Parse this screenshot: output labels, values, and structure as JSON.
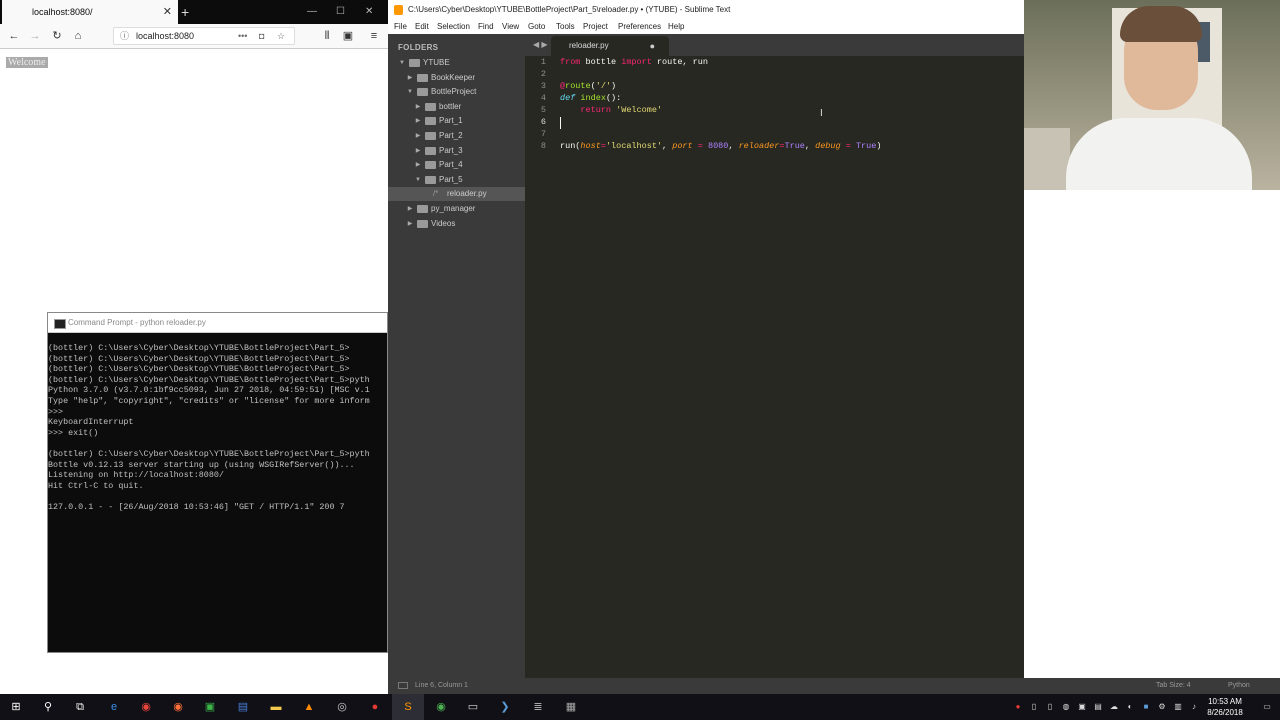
{
  "browser": {
    "tab_title": "localhost:8080/",
    "tab_close": "✕",
    "new_tab": "+",
    "url": "localhost:8080",
    "page_text": "Welcome",
    "window_controls": [
      "—",
      "☐",
      "✕"
    ]
  },
  "cmd": {
    "title": "Command Prompt - python  reloader.py",
    "lines": [
      "(bottler) C:\\Users\\Cyber\\Desktop\\YTUBE\\BottleProject\\Part_5>",
      "(bottler) C:\\Users\\Cyber\\Desktop\\YTUBE\\BottleProject\\Part_5>",
      "(bottler) C:\\Users\\Cyber\\Desktop\\YTUBE\\BottleProject\\Part_5>",
      "(bottler) C:\\Users\\Cyber\\Desktop\\YTUBE\\BottleProject\\Part_5>pyth",
      "Python 3.7.0 (v3.7.0:1bf9cc5093, Jun 27 2018, 04:59:51) [MSC v.1",
      "Type \"help\", \"copyright\", \"credits\" or \"license\" for more inform",
      ">>>",
      "KeyboardInterrupt",
      ">>> exit()",
      "",
      "(bottler) C:\\Users\\Cyber\\Desktop\\YTUBE\\BottleProject\\Part_5>pyth",
      "Bottle v0.12.13 server starting up (using WSGIRefServer())...",
      "Listening on http://localhost:8080/",
      "Hit Ctrl-C to quit.",
      "",
      "127.0.0.1 - - [26/Aug/2018 10:53:46] \"GET / HTTP/1.1\" 200 7"
    ]
  },
  "sublime": {
    "title": "C:\\Users\\Cyber\\Desktop\\YTUBE\\BottleProject\\Part_5\\reloader.py • (YTUBE) - Sublime Text",
    "menu": [
      "File",
      "Edit",
      "Selection",
      "Find",
      "View",
      "Goto",
      "Tools",
      "Project",
      "Preferences",
      "Help"
    ],
    "folders_header": "FOLDERS",
    "tree": [
      {
        "label": "YTUBE",
        "depth": 0,
        "open": true
      },
      {
        "label": "BookKeeper",
        "depth": 1,
        "open": false
      },
      {
        "label": "BottleProject",
        "depth": 1,
        "open": true
      },
      {
        "label": "bottler",
        "depth": 2,
        "open": false
      },
      {
        "label": "Part_1",
        "depth": 2,
        "open": false
      },
      {
        "label": "Part_2",
        "depth": 2,
        "open": false
      },
      {
        "label": "Part_3",
        "depth": 2,
        "open": false
      },
      {
        "label": "Part_4",
        "depth": 2,
        "open": false
      },
      {
        "label": "Part_5",
        "depth": 2,
        "open": true
      },
      {
        "label": "reloader.py",
        "depth": 3,
        "file": true
      },
      {
        "label": "py_manager",
        "depth": 1,
        "open": false
      },
      {
        "label": "Videos",
        "depth": 1,
        "open": false
      }
    ],
    "tab_label": "reloader.py",
    "line_numbers": [
      "1",
      "2",
      "3",
      "4",
      "5",
      "6",
      "7",
      "8"
    ],
    "status_left": "Line 6, Column 1",
    "status_tab": "Tab Size: 4",
    "status_syntax": "Python"
  },
  "taskbar": {
    "time": "10:53 AM",
    "date": "8/26/2018"
  },
  "colors": {
    "editor_bg": "#272822",
    "sidebar_bg": "#3a3a3a",
    "keyword": "#f92672",
    "string": "#e6db74",
    "number": "#ae81ff"
  }
}
